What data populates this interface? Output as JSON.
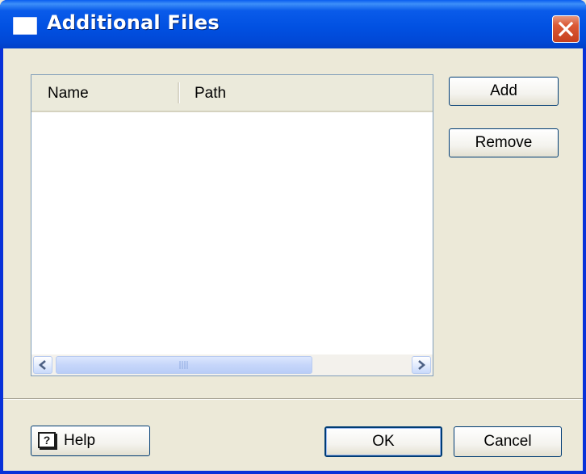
{
  "window": {
    "title": "Additional Files",
    "close_symbol": "✕"
  },
  "list": {
    "columns": [
      "Name",
      "Path"
    ],
    "rows": [],
    "scrollbar_thumb_grip": "III"
  },
  "buttons": {
    "add": "Add",
    "remove": "Remove",
    "help": "Help",
    "ok": "OK",
    "cancel": "Cancel"
  },
  "icons": {
    "title": "window-icon",
    "close": "close-icon",
    "help": "help-book-icon",
    "scroll_left": "arrow-left-icon",
    "scroll_right": "arrow-right-icon"
  },
  "colors": {
    "titlebar": "#0151e2",
    "dialog_background": "#ece9d8",
    "close_button": "#db5a36",
    "button_border": "#003c74"
  }
}
